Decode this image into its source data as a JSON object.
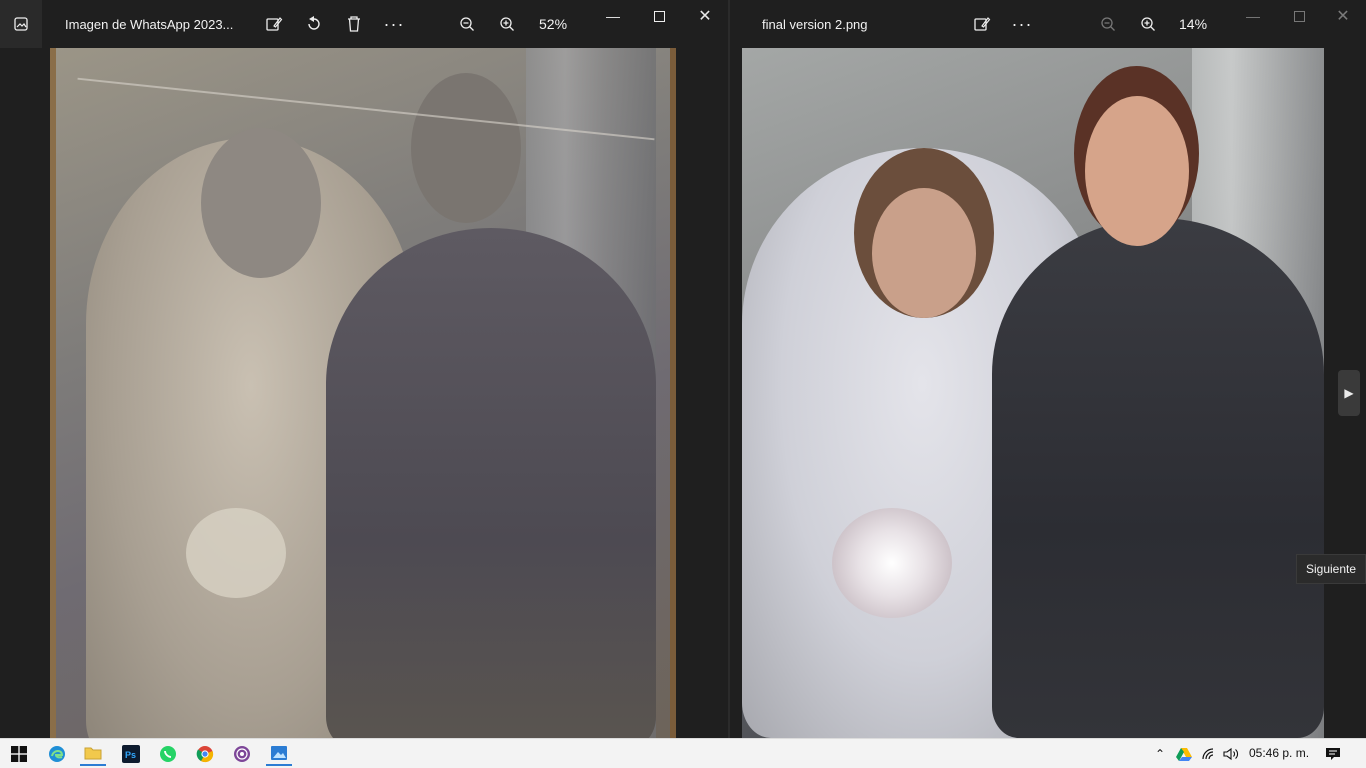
{
  "left_window": {
    "title": "Imagen de WhatsApp 2023...",
    "zoom": "52%",
    "toolbar": [
      "edit-image",
      "rotate",
      "delete",
      "more"
    ]
  },
  "right_window": {
    "title": "final version 2.png",
    "zoom": "14%",
    "toolbar": [
      "edit-image",
      "more"
    ]
  },
  "tooltip": "Siguiente",
  "taskbar": {
    "time": "05:46 p. m."
  }
}
